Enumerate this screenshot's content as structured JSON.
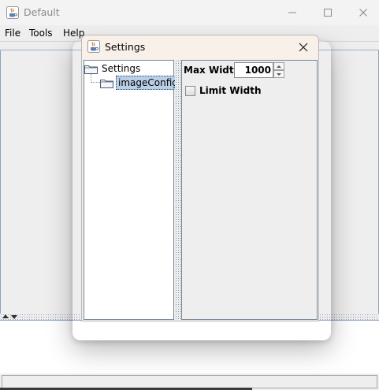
{
  "main_window": {
    "title": "Default",
    "icon": "java-coffee-cup-icon",
    "controls": [
      "minimize-icon",
      "maximize-icon",
      "close-icon"
    ]
  },
  "menubar": {
    "items": [
      {
        "label": "File"
      },
      {
        "label": "Tools"
      },
      {
        "label": "Help"
      }
    ]
  },
  "dialog": {
    "title": "Settings",
    "icon": "java-coffee-cup-icon",
    "tree": {
      "root": {
        "label": "Settings",
        "icon": "folder-icon"
      },
      "children": [
        {
          "label": "imageConfig",
          "icon": "folder-icon",
          "selected": true
        }
      ]
    },
    "config": {
      "max_width_label": "Max Width",
      "max_width_value": "1000",
      "limit_width_label": "Limit Width",
      "limit_width_checked": false
    }
  },
  "colors": {
    "dialog_titlebar": "#f9f1e9",
    "selection": "#b8cfe5",
    "panel_bg": "#eeeeee"
  }
}
